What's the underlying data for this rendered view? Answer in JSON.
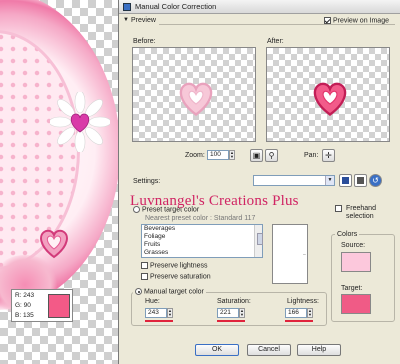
{
  "canvas": {
    "readout": {
      "r": "R: 243",
      "g": "G: 90",
      "b": "B: 135"
    },
    "swatch_color": "#f35a87"
  },
  "dialog": {
    "title": "Manual Color Correction",
    "preview_section": "Preview",
    "preview_on_image": "Preview on Image",
    "before_label": "Before:",
    "after_label": "After:",
    "zoom_label": "Zoom:",
    "zoom_value": "100",
    "pan_label": "Pan:",
    "settings_label": "Settings:",
    "watermark": "Luvnangel's Creations Plus",
    "preset_target": "Preset target color",
    "nearest_preset": "Nearest preset color : Standard 117",
    "preset_items": [
      "Beverages",
      "Foliage",
      "Fruits",
      "Grasses"
    ],
    "freehand": "Freehand selection",
    "preserve_lightness": "Preserve lightness",
    "preserve_saturation": "Preserve saturation",
    "colors_group": "Colors",
    "source_label": "Source:",
    "target_label": "Target:",
    "manual_target": "Manual target color",
    "hue_label": "Hue:",
    "hue_value": "243",
    "saturation_label": "Saturation:",
    "saturation_value": "221",
    "lightness_label": "Lightness:",
    "lightness_value": "166",
    "ok": "OK",
    "cancel": "Cancel",
    "help": "Help",
    "source_color": "#fcc8dc",
    "target_color": "#f05b86"
  }
}
